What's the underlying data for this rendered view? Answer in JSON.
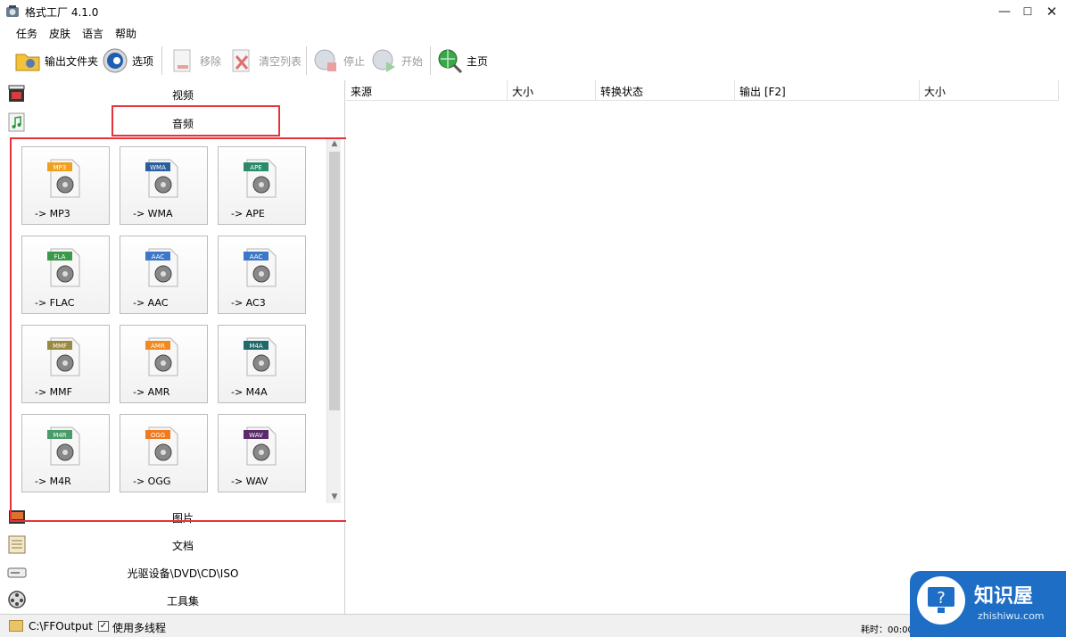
{
  "window": {
    "title": "格式工厂 4.1.0",
    "minimize": "—",
    "maximize": "☐",
    "close": "✕"
  },
  "menu": [
    "任务",
    "皮肤",
    "语言",
    "帮助"
  ],
  "toolbar": {
    "output_folder": "输出文件夹",
    "options": "选项",
    "remove": "移除",
    "clear_list": "清空列表",
    "stop": "停止",
    "start": "开始",
    "home": "主页"
  },
  "categories": {
    "video": "视频",
    "audio": "音频",
    "image": "图片",
    "document": "文档",
    "disc": "光驱设备\\DVD\\CD\\ISO",
    "tools": "工具集"
  },
  "audio_formats": [
    {
      "badge": "MP3",
      "label": "-> MP3",
      "color": "#f0a020"
    },
    {
      "badge": "WMA",
      "label": "-> WMA",
      "color": "#2a5f9e"
    },
    {
      "badge": "APE",
      "label": "-> APE",
      "color": "#2a8a6a"
    },
    {
      "badge": "FLA",
      "label": "-> FLAC",
      "color": "#3b9a4a"
    },
    {
      "badge": "AAC",
      "label": "-> AAC",
      "color": "#3d78c8"
    },
    {
      "badge": "AAC",
      "label": "-> AC3",
      "color": "#3d78c8"
    },
    {
      "badge": "MMF",
      "label": "-> MMF",
      "color": "#9a8a40"
    },
    {
      "badge": "AMR",
      "label": "-> AMR",
      "color": "#f08a20"
    },
    {
      "badge": "M4A",
      "label": "-> M4A",
      "color": "#1f6a6a"
    },
    {
      "badge": "M4R",
      "label": "-> M4R",
      "color": "#4a9a6a"
    },
    {
      "badge": "OGG",
      "label": "-> OGG",
      "color": "#f07a20"
    },
    {
      "badge": "WAV",
      "label": "-> WAV",
      "color": "#5a2a6a"
    }
  ],
  "list_columns": [
    "来源",
    "大小",
    "转换状态",
    "输出 [F2]",
    "大小"
  ],
  "status": {
    "output_path": "C:\\FFOutput",
    "multithread_label": "使用多线程",
    "elapsed": "耗时：00:00:0"
  },
  "watermark": {
    "title": "知识屋",
    "url": "zhishiwu.com"
  },
  "colors": {
    "highlight": "#e5333a",
    "watermark_bg": "#1f6ec6"
  }
}
